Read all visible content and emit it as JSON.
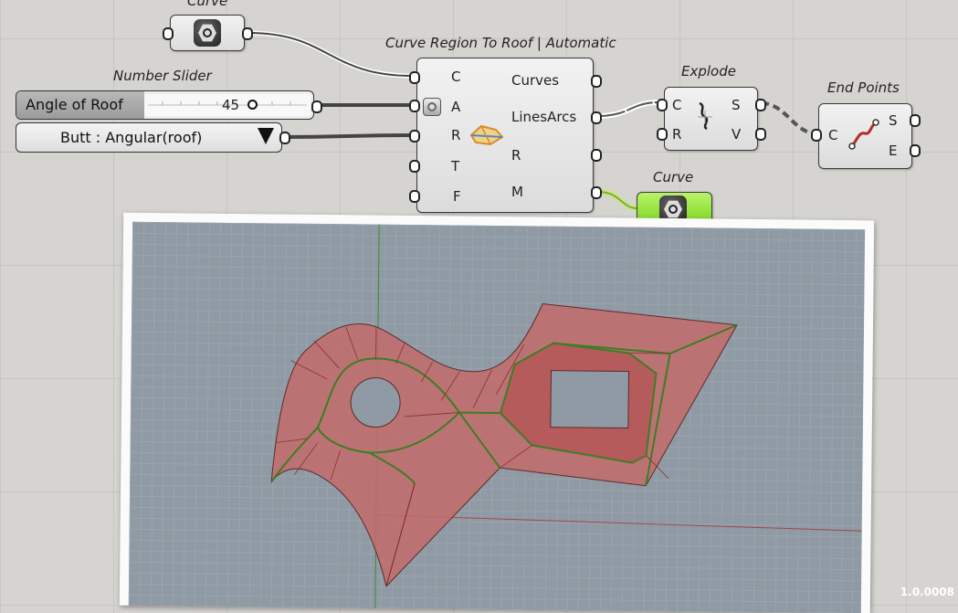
{
  "components": {
    "curve_input": {
      "title": "Curve",
      "icon": "curve-param-icon"
    },
    "number_slider": {
      "title": "Number Slider",
      "label": "Angle of Roof",
      "value": "45"
    },
    "value_list": {
      "value": "Butt  : Angular(roof)"
    },
    "roof": {
      "title": "Curve Region To Roof | Automatic",
      "inputs": [
        "C",
        "A",
        "R",
        "T",
        "F"
      ],
      "outputs": [
        "Curves",
        "LinesArcs",
        "R",
        "M"
      ],
      "icon": "roof-icon"
    },
    "explode": {
      "title": "Explode",
      "inputs": [
        "C",
        "R"
      ],
      "outputs": [
        "S",
        "V"
      ],
      "icon": "explode-icon"
    },
    "end_points": {
      "title": "End Points",
      "inputs": [
        "C"
      ],
      "outputs": [
        "S",
        "E"
      ],
      "icon": "end-points-icon"
    },
    "curve_output": {
      "title": "Curve",
      "icon": "curve-param-icon",
      "color": "#8fe12c"
    }
  },
  "version": "1.0.0008",
  "colors": {
    "wire": "#444444",
    "roof_fill": "#c46a6a",
    "roof_edge": "#3e7d24",
    "viewport_bg": "#8f9aa4"
  }
}
